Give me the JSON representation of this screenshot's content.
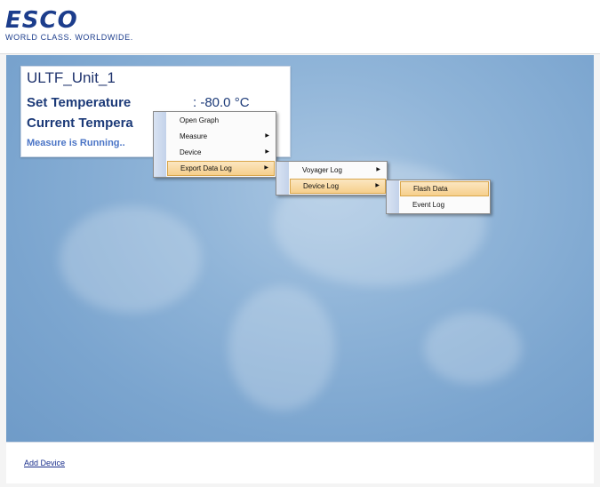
{
  "header": {
    "logo_text": "ESCO",
    "tagline": "WORLD CLASS. WORLDWIDE."
  },
  "unit": {
    "name": "ULTF_Unit_1",
    "set_label": "Set Temperature",
    "set_value": ": -80.0 °C",
    "current_label": "Current Tempera",
    "status": "Measure is Running.."
  },
  "context_menu": {
    "items": [
      "Open Graph",
      "Measure",
      "Device",
      "Export Data Log"
    ],
    "highlighted": "Export Data Log"
  },
  "export_submenu": {
    "items": [
      "Voyager Log",
      "Device Log"
    ],
    "highlighted": "Device Log"
  },
  "device_log_submenu": {
    "items": [
      "Flash Data",
      "Event Log"
    ],
    "highlighted": "Flash Data"
  },
  "footer": {
    "add_device": "Add Device"
  },
  "colors": {
    "brand": "#1c3d8c",
    "background": "#7ba5cf",
    "highlight": "#f6cf8c"
  },
  "icons": [
    "submenu-arrow-icon"
  ]
}
